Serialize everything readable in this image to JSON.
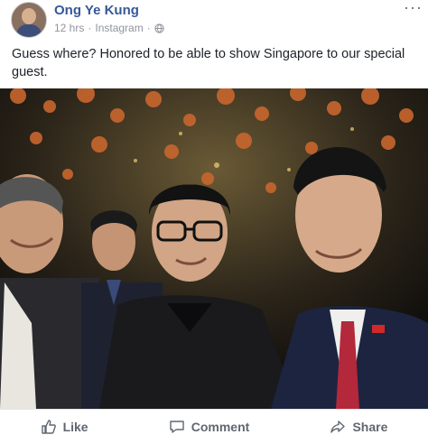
{
  "post": {
    "author": "Ong Ye Kung",
    "time": "12 hrs",
    "separator": "·",
    "source": "Instagram",
    "text": "Guess where? Honored to be able to show Singapore to our special guest.",
    "more_label": "···",
    "avatar_icon": "user-avatar",
    "privacy_icon": "globe-icon"
  },
  "actions": {
    "like_label": "Like",
    "comment_label": "Comment",
    "share_label": "Share"
  },
  "colors": {
    "author_link": "#365899",
    "meta_text": "#90949c",
    "action_text": "#606770"
  }
}
